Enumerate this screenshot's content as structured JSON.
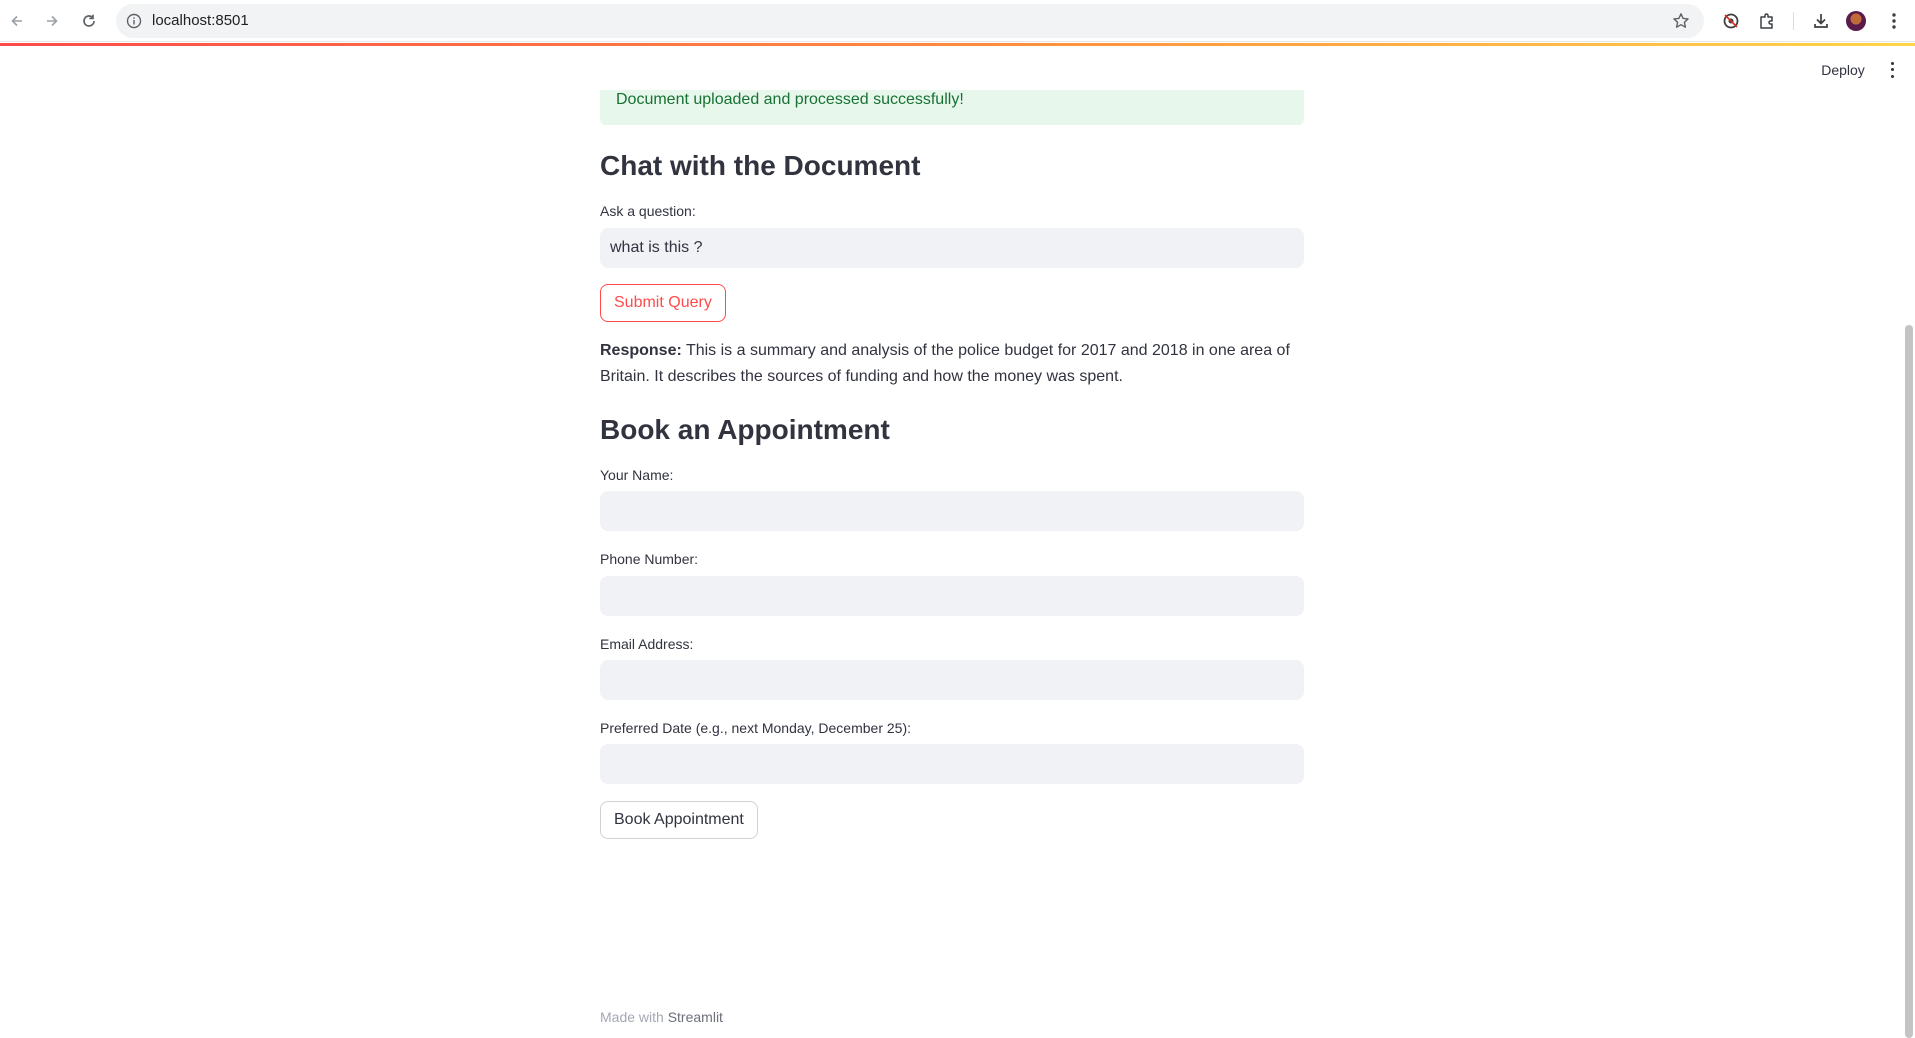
{
  "browser": {
    "url": "localhost:8501",
    "icons": [
      "back-icon",
      "forward-icon",
      "reload-icon",
      "info-icon",
      "star-icon",
      "extension-shield-icon",
      "puzzle-icon",
      "download-icon",
      "avatar",
      "menu-icon"
    ]
  },
  "header": {
    "deploy_label": "Deploy"
  },
  "success": {
    "message": "Document uploaded and processed successfully!"
  },
  "chat": {
    "title": "Chat with the Document",
    "question_label": "Ask a question:",
    "question_value": "what is this ?",
    "submit_label": "Submit Query",
    "response_label": "Response:",
    "response_text": "This is a summary and analysis of the police budget for 2017 and 2018 in one area of Britain. It describes the sources of funding and how the money was spent."
  },
  "booking": {
    "title": "Book an Appointment",
    "name_label": "Your Name:",
    "name_value": "",
    "phone_label": "Phone Number:",
    "phone_value": "",
    "email_label": "Email Address:",
    "email_value": "",
    "date_label": "Preferred Date (e.g., next Monday, December 25):",
    "date_value": "",
    "book_label": "Book Appointment"
  },
  "footer": {
    "made_with": "Made with",
    "brand": "Streamlit"
  },
  "colors": {
    "accent": "#ff4b4b",
    "success_bg": "#e8f7ec",
    "success_text": "#177233",
    "input_bg": "#f0f2f6"
  }
}
